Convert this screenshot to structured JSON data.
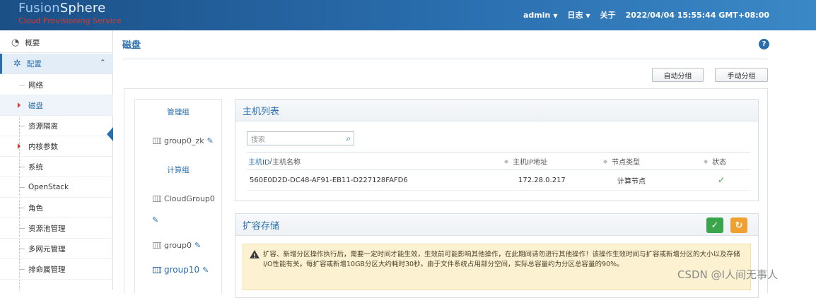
{
  "header": {
    "brand_fusion": "Fusion",
    "brand_sphere": "Sphere",
    "brand_sub": "Cloud Provisioning Service",
    "user": "admin",
    "log": "日志",
    "about": "关于",
    "datetime": "2022/04/04 15:55:44 GMT+08:00"
  },
  "sidebar": {
    "overview": "概要",
    "config": "配置",
    "items": [
      {
        "label": "网络"
      },
      {
        "label": "磁盘"
      },
      {
        "label": "资源隔离"
      },
      {
        "label": "内核参数"
      },
      {
        "label": "系统"
      },
      {
        "label": "OpenStack"
      },
      {
        "label": "角色"
      },
      {
        "label": "资源池管理"
      },
      {
        "label": "多网元管理"
      },
      {
        "label": "排命属管理"
      }
    ]
  },
  "page": {
    "title": "磁盘",
    "auto_group_label": "自动分组",
    "manual_group_label": "手动分组"
  },
  "groups": {
    "mgmt_heading": "管理组",
    "mgmt_items": [
      "group0_zk"
    ],
    "compute_heading": "计算组",
    "compute_items": [
      "CloudGroup0",
      "group0",
      "group10"
    ]
  },
  "host_list": {
    "title": "主机列表",
    "search_placeholder": "搜索",
    "columns": {
      "host_id": "主机ID",
      "sep": " / ",
      "host_name": "主机名称",
      "ip": "主机IP地址",
      "node_type": "节点类型",
      "status": "状态"
    },
    "rows": [
      {
        "host_id": "560E0D2D-DC48-AF91-EB11-D227128FAFD6",
        "ip": "172.28.0.217",
        "node_type": "计算节点"
      }
    ]
  },
  "expand": {
    "title": "扩容存储",
    "warning": "扩容、新增分区操作执行后，需要一定时间才能生效，生效前可能影响其他操作，在此期间请勿进行其他操作！该操作生效时间与扩容或新增分区的大小以及存储I/O性能有关。每扩容或新增10GB分区大约耗时30秒。由于文件系统占用部分空间，实际总容量约为分区总容量的90%。"
  },
  "watermark": "CSDN @I人间无事人",
  "colors": {
    "accent": "#2a6eae",
    "success": "#3aa54b",
    "warning_btn": "#f0a030"
  }
}
